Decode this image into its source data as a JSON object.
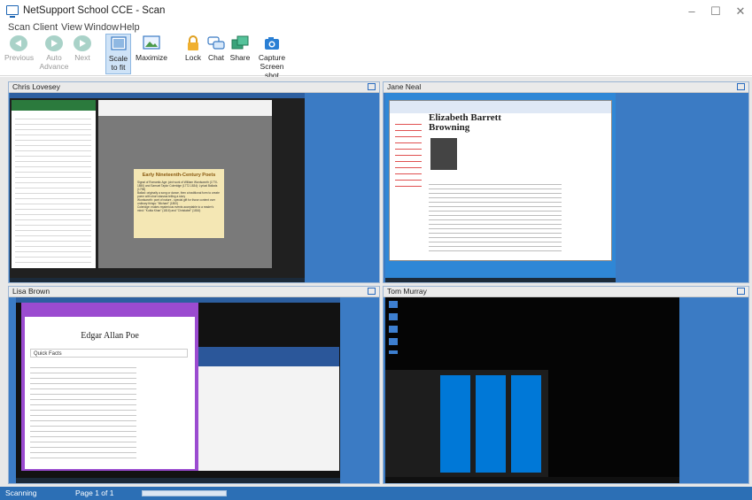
{
  "window": {
    "title": "NetSupport School CCE - Scan",
    "controls": [
      "–",
      "☐",
      "✕"
    ]
  },
  "menu": [
    "Scan",
    "Client",
    "View",
    "Window",
    "Help"
  ],
  "toolbar": {
    "previous": "Previous",
    "auto_line1": "Auto",
    "auto_line2": "Advance",
    "next": "Next",
    "scale_line1": "Scale",
    "scale_line2": "to fit",
    "maximize": "Maximize",
    "lock": "Lock",
    "chat": "Chat",
    "share": "Share",
    "capture_line1": "Capture",
    "capture_line2": "Screen shot"
  },
  "clients": [
    {
      "name": "Chris Lovesey",
      "slide_title": "Early Nineteenth-Century Poets",
      "slide_bullets": [
        "Signal of Romantic Age: joint work of William Wordsworth (1770-1850) and Samuel Taylor Coleridge (1772-1834): Lyrical Ballads (1798)",
        "Ballad: originally a song or dance, then a traditional form to create poem with short stanzas telling a story",
        "Wordsworth: poet of nature - special gift for those content over ordinary things: \"Michael\" (1800)",
        "Coleridge: makes mysterious events acceptable to a reader's mind: \"Kubla Khan\" (1816) and \"Christabel\" (1816)"
      ]
    },
    {
      "name": "Jane Neal",
      "page_heading_line1": "Elizabeth Barrett",
      "page_heading_line2": "Browning"
    },
    {
      "name": "Lisa Brown",
      "page_heading": "Edgar Allan Poe",
      "section_title": "Quick Facts"
    },
    {
      "name": "Tom Murray"
    }
  ],
  "status": {
    "text": "Scanning",
    "page": "Page 1 of 1"
  },
  "colors": {
    "accent": "#2c6fb5",
    "desktop_blue": "#1f6fc0",
    "pane_border": "#9cb6d4"
  }
}
